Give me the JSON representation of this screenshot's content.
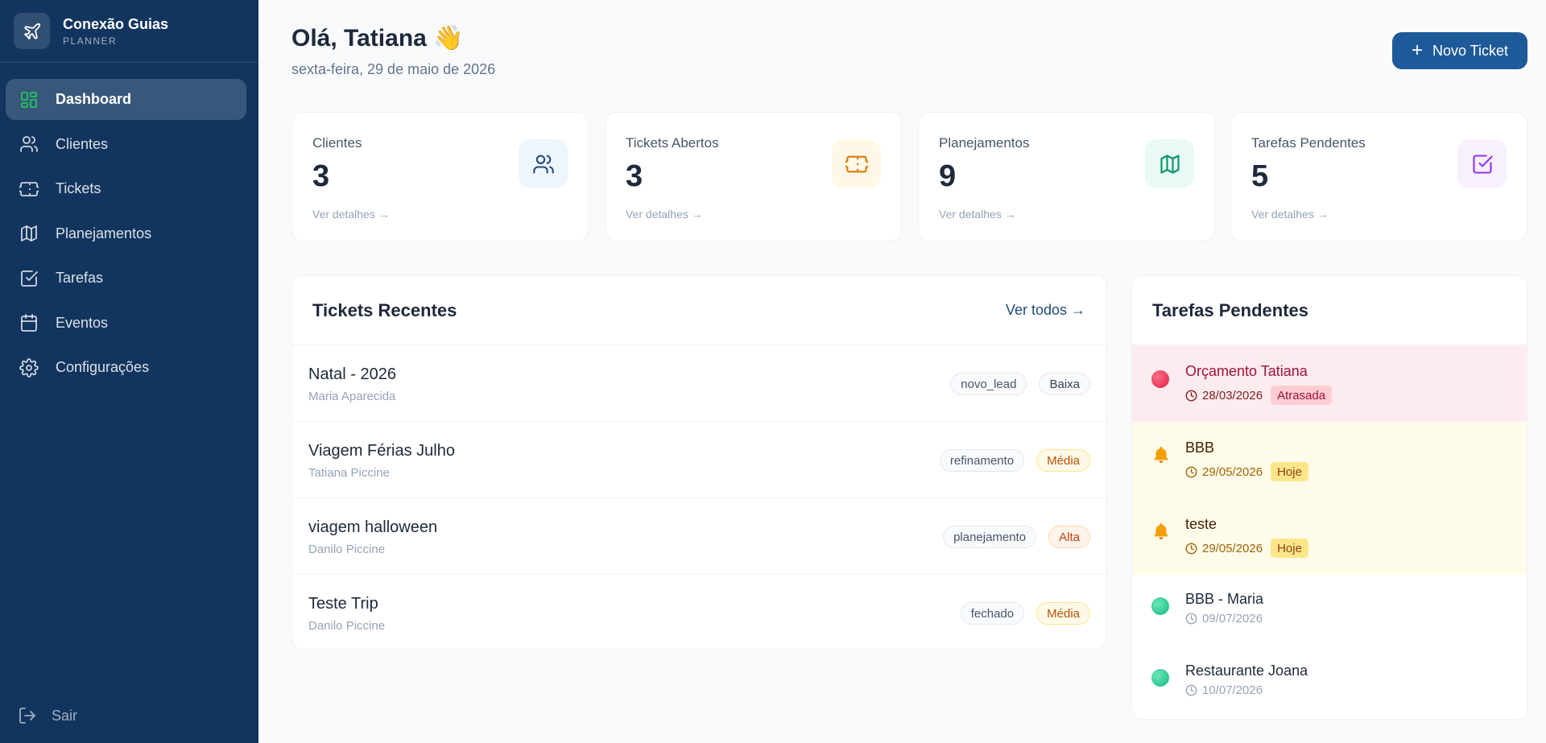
{
  "brand": {
    "name": "Conexão Guias",
    "subtitle": "PLANNER"
  },
  "sidebar": {
    "items": [
      {
        "label": "Dashboard",
        "icon": "dashboard-grid-icon",
        "active": true
      },
      {
        "label": "Clientes",
        "icon": "users-icon"
      },
      {
        "label": "Tickets",
        "icon": "ticket-icon"
      },
      {
        "label": "Planejamentos",
        "icon": "map-icon"
      },
      {
        "label": "Tarefas",
        "icon": "checkbox-icon"
      },
      {
        "label": "Eventos",
        "icon": "calendar-icon"
      },
      {
        "label": "Configurações",
        "icon": "gear-icon"
      }
    ],
    "logout": "Sair"
  },
  "header": {
    "greeting": "Olá, Tatiana 👋",
    "date": "sexta-feira, 29 de maio de 2026",
    "new_ticket_label": "Novo Ticket"
  },
  "stats": [
    {
      "label": "Clientes",
      "value": "3",
      "link": "Ver detalhes →",
      "icon": "users-icon",
      "color": "#1e4a7a"
    },
    {
      "label": "Tickets Abertos",
      "value": "3",
      "link": "Ver detalhes →",
      "icon": "ticket-icon",
      "color": "#d97706"
    },
    {
      "label": "Planejamentos",
      "value": "9",
      "link": "Ver detalhes →",
      "icon": "map-icon",
      "color": "#059669"
    },
    {
      "label": "Tarefas Pendentes",
      "value": "5",
      "link": "Ver detalhes →",
      "icon": "checkbox-icon",
      "color": "#9333ea"
    }
  ],
  "recent_tickets": {
    "title": "Tickets Recentes",
    "see_all": "Ver todos →",
    "rows": [
      {
        "title": "Natal - 2026",
        "client": "Maria Aparecida",
        "status": "novo_lead",
        "priority": "Baixa"
      },
      {
        "title": "Viagem Férias Julho",
        "client": "Tatiana Piccine",
        "status": "refinamento",
        "priority": "Média"
      },
      {
        "title": "viagem halloween",
        "client": "Danilo Piccine",
        "status": "planejamento",
        "priority": "Alta"
      },
      {
        "title": "Teste Trip",
        "client": "Danilo Piccine",
        "status": "fechado",
        "priority": "Média"
      }
    ]
  },
  "pending_tasks": {
    "title": "Tarefas Pendentes",
    "rows": [
      {
        "title": "Orçamento Tatiana",
        "date": "28/03/2026",
        "tag": "Atrasada",
        "state": "overdue"
      },
      {
        "title": "BBB",
        "date": "29/05/2026",
        "tag": "Hoje",
        "state": "today"
      },
      {
        "title": "teste",
        "date": "29/05/2026",
        "tag": "Hoje",
        "state": "today"
      },
      {
        "title": "BBB - Maria",
        "date": "09/07/2026",
        "tag": "",
        "state": "future"
      },
      {
        "title": "Restaurante Joana",
        "date": "10/07/2026",
        "tag": "",
        "state": "future"
      }
    ]
  },
  "colors": {
    "sidebar": "#12355f",
    "accent": "#1e5a99",
    "active_icon": "#22c55e"
  }
}
